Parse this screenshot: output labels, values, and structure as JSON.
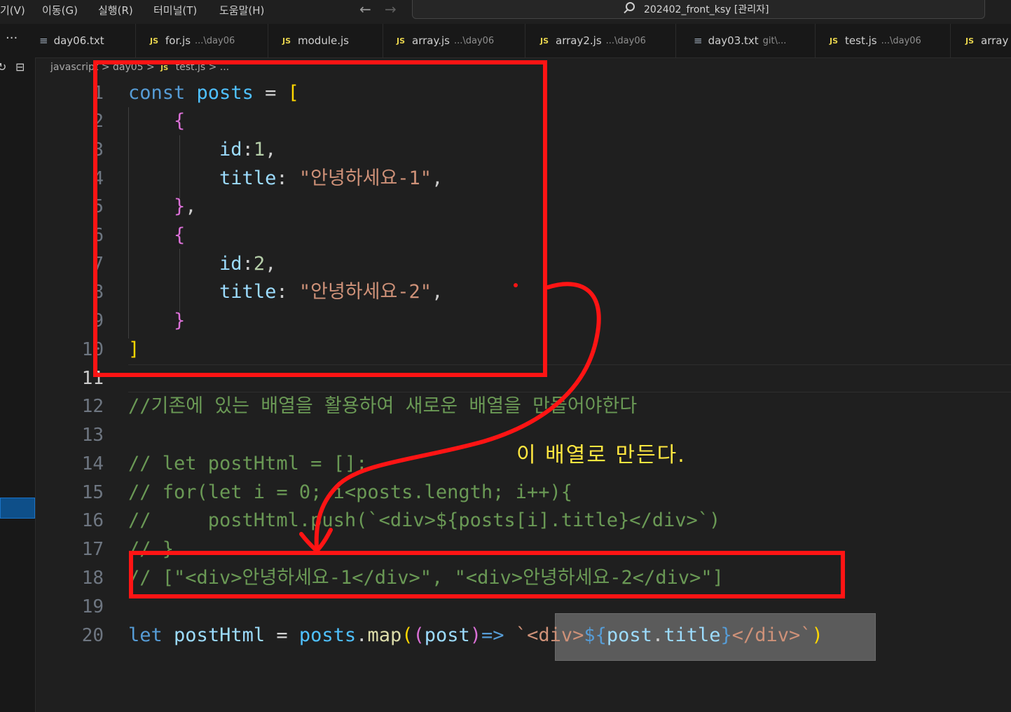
{
  "menu": {
    "items": [
      "기(V)",
      "이동(G)",
      "실행(R)",
      "터미널(T)",
      "도움말(H)"
    ]
  },
  "titlebar": {
    "back_arrow": "←",
    "forward_arrow": "→",
    "search_text": "202402_front_ksy [관리자]"
  },
  "tabs": {
    "more": "···",
    "items": [
      {
        "icon": "txt",
        "name": "day06.txt",
        "path": ""
      },
      {
        "icon": "js",
        "name": "for.js",
        "path": "...\\day06"
      },
      {
        "icon": "js",
        "name": "module.js",
        "path": ""
      },
      {
        "icon": "js",
        "name": "array.js",
        "path": "...\\day06"
      },
      {
        "icon": "js",
        "name": "array2.js",
        "path": "...\\day06"
      },
      {
        "icon": "txt",
        "name": "day03.txt",
        "path": "git\\..."
      },
      {
        "icon": "js",
        "name": "test.js",
        "path": "...\\day06"
      },
      {
        "icon": "js",
        "name": "array",
        "path": ""
      }
    ]
  },
  "breadcrumb": {
    "p1": "javascript",
    "sep": ">",
    "p2": "day05",
    "js_badge": "JS",
    "p3": "test.js",
    "p4": "..."
  },
  "editor": {
    "line_numbers": [
      "1",
      "2",
      "3",
      "4",
      "5",
      "6",
      "7",
      "8",
      "9",
      "10",
      "11",
      "12",
      "13",
      "14",
      "15",
      "16",
      "17",
      "18",
      "19",
      "20"
    ],
    "code": {
      "l1_kw": "const",
      "l1_var": "posts",
      "l1_op": "=",
      "l1_br": "[",
      "l2_br": "{",
      "l3_key": "id",
      "l3_val": "1",
      "l4_key": "title",
      "l4_str": "\"안녕하세요-1\"",
      "l5_br": "}",
      "l6_br": "{",
      "l7_key": "id",
      "l7_val": "2",
      "l8_key": "title",
      "l8_str": "\"안녕하세요-2\"",
      "l9_br": "}",
      "l10_br": "]",
      "l12": "//기존에 있는 배열을 활용하여 새로운 배열을 만들어야한다",
      "l14": "// let postHtml = [];",
      "l15": "// for(let i = 0; i<posts.length; i++){",
      "l16": "//     postHtml.push(`<div>${posts[i].title}</div>`)",
      "l17": "// }",
      "l18": "// [\"<div>안녕하세요-1</div>\", \"<div>안녕하세요-2</div>\"]",
      "l20_kw": "let",
      "l20_var": "postHtml",
      "l20_op": "=",
      "l20_obj": "posts",
      "l20_fn": "map",
      "l20_param": "post",
      "l20_arrow": "=>",
      "l20_str_a": "`<div>",
      "l20_tpl_open": "${",
      "l20_tpl_var": "post",
      "l20_tpl_prop": "title",
      "l20_tpl_close": "}",
      "l20_str_b": "</div>`"
    }
  },
  "annotation": {
    "text": "이 배열로 만든다."
  },
  "colors": {
    "annotation_red": "#ff1414",
    "annotation_text": "#ffe740"
  }
}
